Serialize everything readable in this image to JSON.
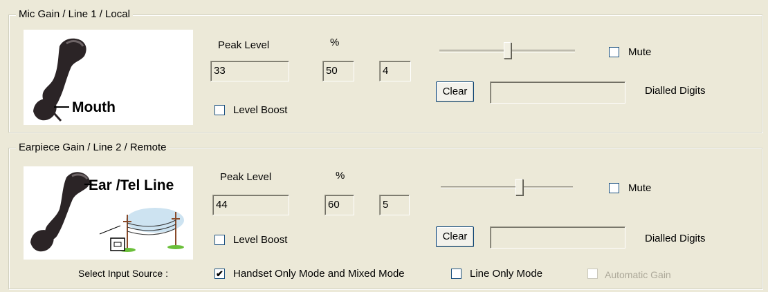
{
  "mic_group": {
    "title": "Mic Gain / Line 1 / Local",
    "image_label": "Mouth",
    "image_icon": "handset-icon",
    "peak_level_label": "Peak Level",
    "percent_label": "%",
    "peak_level_value": "33",
    "percent_value": "50",
    "level_value": "4",
    "slider_percent": 50,
    "mute_label": "Mute",
    "mute_checked": false,
    "clear_label": "Clear",
    "dialled_digits_value": "",
    "dialled_digits_label": "Dialled Digits",
    "level_boost_label": "Level Boost",
    "level_boost_checked": false
  },
  "earpiece_group": {
    "title": "Earpiece Gain / Line 2 / Remote",
    "image_label": "Ear /Tel Line",
    "image_icon": "handset-telephone-line-icon",
    "peak_level_label": "Peak Level",
    "percent_label": "%",
    "peak_level_value": "44",
    "percent_value": "60",
    "level_value": "5",
    "slider_percent": 60,
    "mute_label": "Mute",
    "mute_checked": false,
    "clear_label": "Clear",
    "dialled_digits_value": "",
    "dialled_digits_label": "Dialled Digits",
    "level_boost_label": "Level Boost",
    "level_boost_checked": false,
    "input_source": {
      "label": "Select Input Source :",
      "handset_mode_label": "Handset Only Mode and Mixed Mode",
      "handset_mode_checked": true,
      "line_only_label": "Line Only Mode",
      "line_only_checked": false,
      "automatic_gain_label": "Automatic Gain",
      "automatic_gain_checked": false,
      "automatic_gain_enabled": false
    }
  },
  "check_glyph": "✔"
}
